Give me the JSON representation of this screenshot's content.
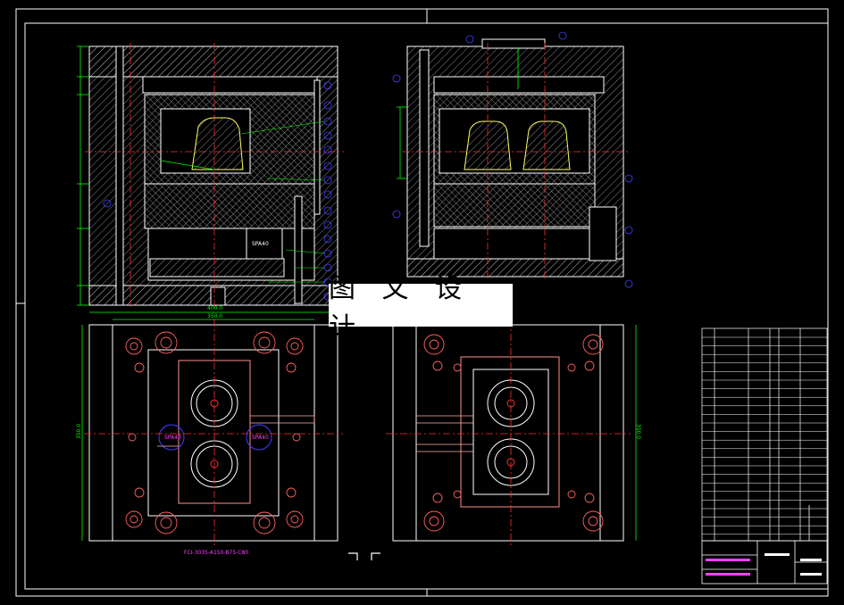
{
  "watermark": "图 文 设 计",
  "plate_code": "FCI-3035-A150-B75-C80",
  "insert_label_1": "SPA40",
  "insert_label_2": "SPA40",
  "insert_label_3": "SPA40",
  "dim_left_width": "400.0",
  "dim_left_inner": "350.0",
  "dim_right_height": "350.0",
  "dim_left_height": "350.0",
  "colors": {
    "background": "#000000",
    "frame": "#ffffff",
    "geometry": "#ffffff",
    "centerline": "#ff3030",
    "dimension": "#00ff00",
    "callout": "#4040ff",
    "text": "#ff40ff",
    "hatch": "#c8c8c8",
    "cavity": "#ffff60"
  }
}
